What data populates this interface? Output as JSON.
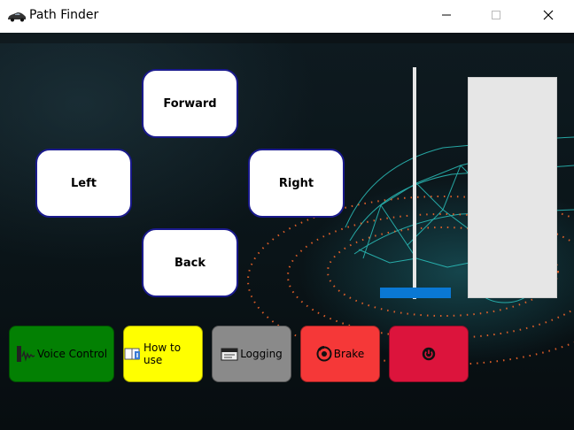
{
  "window": {
    "title": "Path Finder"
  },
  "controls": {
    "forward": "Forward",
    "left": "Left",
    "right": "Right",
    "back": "Back"
  },
  "actions": {
    "voice_control": "Voice Control",
    "how_to_use": "How to use",
    "logging": "Logging",
    "brake": "Brake"
  },
  "colors": {
    "voice_control": "#038003",
    "how_to_use": "#ffff00",
    "logging": "#8a8a8a",
    "brake": "#f53838",
    "power": "#dc143c",
    "slider_handle": "#0a78d4",
    "button_border": "#1a1a8c"
  },
  "icons": {
    "app": "car-icon",
    "minimize": "minimize-icon",
    "maximize": "maximize-icon",
    "close": "close-icon",
    "voice_control": "microphone-waveform-icon",
    "how_to_use": "book-info-icon",
    "logging": "log-window-icon",
    "brake": "brake-disc-icon",
    "power": "power-icon"
  },
  "slider": {
    "value_fraction": 0.0
  }
}
